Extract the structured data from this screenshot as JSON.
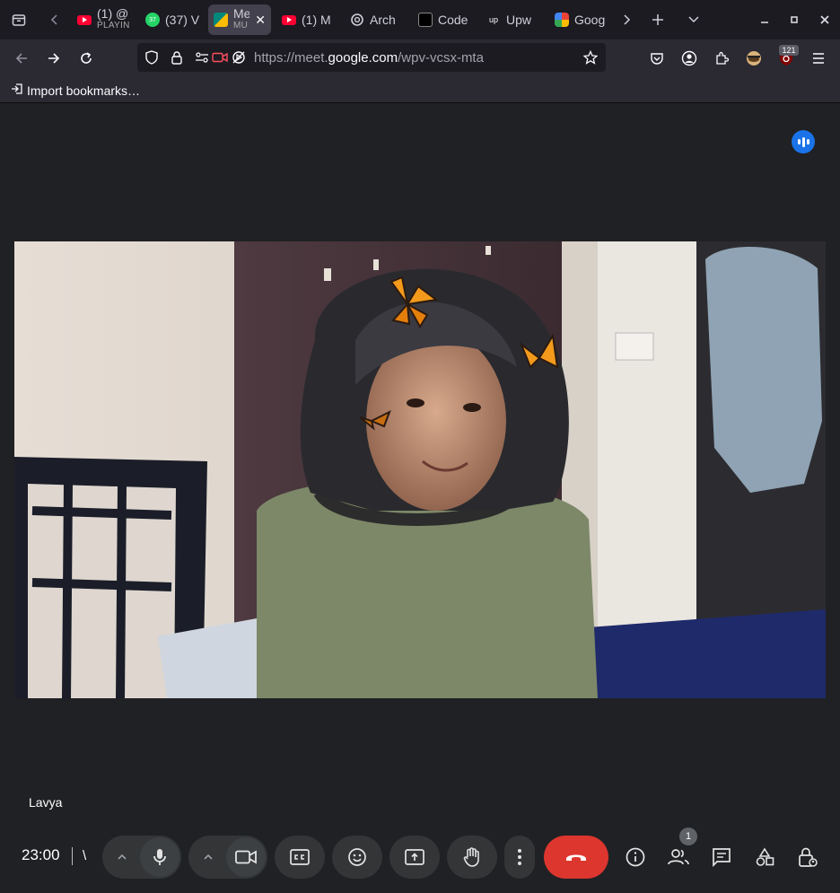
{
  "tabs": [
    {
      "title": "(1) @",
      "sub": "PLAYIN",
      "favicon": "youtube-icon",
      "color": "#ff0033"
    },
    {
      "title": "(37) V",
      "sub": "",
      "favicon": "whatsapp-icon",
      "color": "#25d366",
      "fav_text": "37"
    },
    {
      "title": "Me",
      "sub": "MU",
      "favicon": "google-meet-icon",
      "color": "#00897b",
      "active": true
    },
    {
      "title": "(1) M",
      "sub": "",
      "favicon": "youtube-icon",
      "color": "#ff0033"
    },
    {
      "title": "Arch",
      "sub": "",
      "favicon": "openai-icon",
      "color": "#cfcfd8"
    },
    {
      "title": "Code",
      "sub": "",
      "favicon": "code-icon",
      "color": "#000000"
    },
    {
      "title": "Upw",
      "sub": "",
      "favicon": "upwork-icon",
      "color": "#1c1b22",
      "fav_text": "up"
    },
    {
      "title": "Goog",
      "sub": "",
      "favicon": "google-workspace-icon",
      "color": "#fbbc04"
    }
  ],
  "browser": {
    "url_host_pre": "https://meet.",
    "url_host": "google.com",
    "url_path": "/wpv-vcsx-mta",
    "extension_badge": "121",
    "import_bookmarks": "Import bookmarks…"
  },
  "meet": {
    "participant_name": "Lavya",
    "clock": "23:00",
    "clock_trailing": "\\",
    "people_count": "1"
  },
  "colors": {
    "accent": "#1a73e8",
    "end_call": "#dc362e",
    "control_bg": "#333537",
    "meet_bg": "#202124"
  }
}
